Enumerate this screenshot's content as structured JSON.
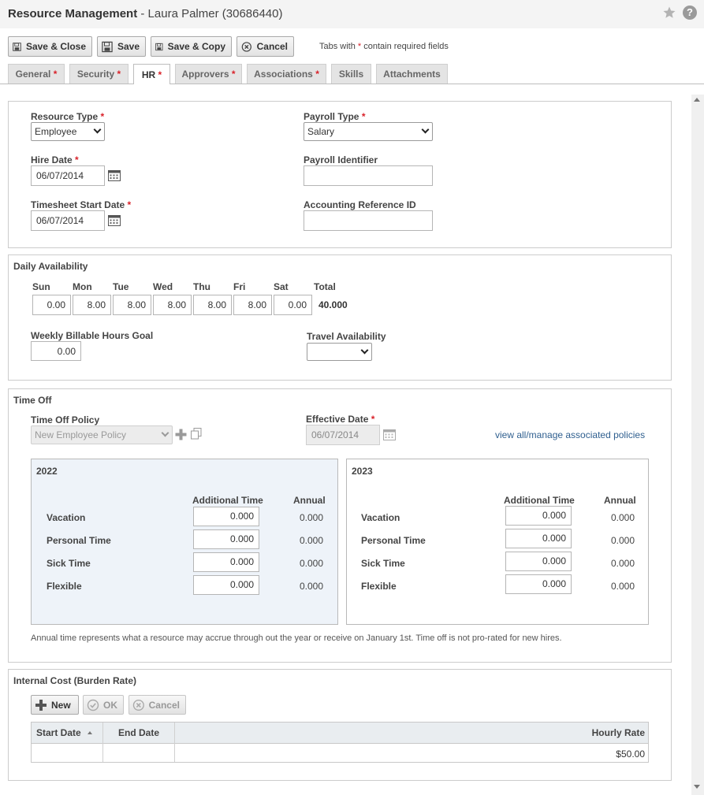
{
  "window": {
    "title": "Resource Management",
    "subtitle": " - Laura Palmer (30686440)"
  },
  "toolbar": {
    "save_close": "Save & Close",
    "save": "Save",
    "save_copy": "Save & Copy",
    "cancel": "Cancel",
    "required_note_prefix": "Tabs with ",
    "required_star": "*",
    "required_note_suffix": " contain required fields"
  },
  "tabs": [
    {
      "label": "General",
      "required": "*"
    },
    {
      "label": "Security",
      "required": "*"
    },
    {
      "label": "HR",
      "required": "*"
    },
    {
      "label": "Approvers",
      "required": "*"
    },
    {
      "label": "Associations",
      "required": "*"
    },
    {
      "label": "Skills",
      "required": ""
    },
    {
      "label": "Attachments",
      "required": ""
    }
  ],
  "general": {
    "resource_type_label": "Resource Type",
    "resource_type_value": "Employee",
    "payroll_type_label": "Payroll Type",
    "payroll_type_value": "Salary",
    "hire_date_label": "Hire Date",
    "hire_date_value": "06/07/2014",
    "payroll_identifier_label": "Payroll Identifier",
    "payroll_identifier_value": "",
    "timesheet_start_label": "Timesheet Start Date",
    "timesheet_start_value": "06/07/2014",
    "accounting_ref_label": "Accounting Reference ID",
    "accounting_ref_value": "",
    "star": "*"
  },
  "availability": {
    "title": "Daily Availability",
    "days": [
      "Sun",
      "Mon",
      "Tue",
      "Wed",
      "Thu",
      "Fri",
      "Sat"
    ],
    "values": [
      "0.00",
      "8.00",
      "8.00",
      "8.00",
      "8.00",
      "8.00",
      "0.00"
    ],
    "total_label": "Total",
    "total_value": "40.000",
    "weekly_goal_label": "Weekly Billable Hours Goal",
    "weekly_goal_value": "0.00",
    "travel_label": "Travel Availability",
    "travel_value": ""
  },
  "time_off": {
    "title": "Time Off",
    "policy_label": "Time Off Policy",
    "policy_value": "New Employee Policy",
    "effective_label": "Effective Date",
    "effective_value": "06/07/2014",
    "star": "*",
    "link": "view all/manage associated policies",
    "additional_header": "Additional Time",
    "annual_header": "Annual",
    "years": [
      {
        "year": "2022",
        "rows": [
          {
            "name": "Vacation",
            "additional": "0.000",
            "annual": "0.000"
          },
          {
            "name": "Personal Time",
            "additional": "0.000",
            "annual": "0.000"
          },
          {
            "name": "Sick Time",
            "additional": "0.000",
            "annual": "0.000"
          },
          {
            "name": "Flexible",
            "additional": "0.000",
            "annual": "0.000"
          }
        ]
      },
      {
        "year": "2023",
        "rows": [
          {
            "name": "Vacation",
            "additional": "0.000",
            "annual": "0.000"
          },
          {
            "name": "Personal Time",
            "additional": "0.000",
            "annual": "0.000"
          },
          {
            "name": "Sick Time",
            "additional": "0.000",
            "annual": "0.000"
          },
          {
            "name": "Flexible",
            "additional": "0.000",
            "annual": "0.000"
          }
        ]
      }
    ],
    "note": "Annual time represents what a resource may accrue through out the year or receive on January 1st. Time off is not pro-rated for new hires."
  },
  "internal_cost": {
    "title": "Internal Cost (Burden Rate)",
    "new_label": "New",
    "ok_label": "OK",
    "cancel_label": "Cancel",
    "columns": [
      "Start Date",
      "End Date",
      "Hourly Rate"
    ],
    "rows": [
      {
        "start": "",
        "end": "",
        "rate": "$50.00"
      }
    ]
  },
  "colors": {
    "required_star": "#d9222a",
    "link": "#2f5f8f",
    "year_highlight": "#eef3f9"
  }
}
